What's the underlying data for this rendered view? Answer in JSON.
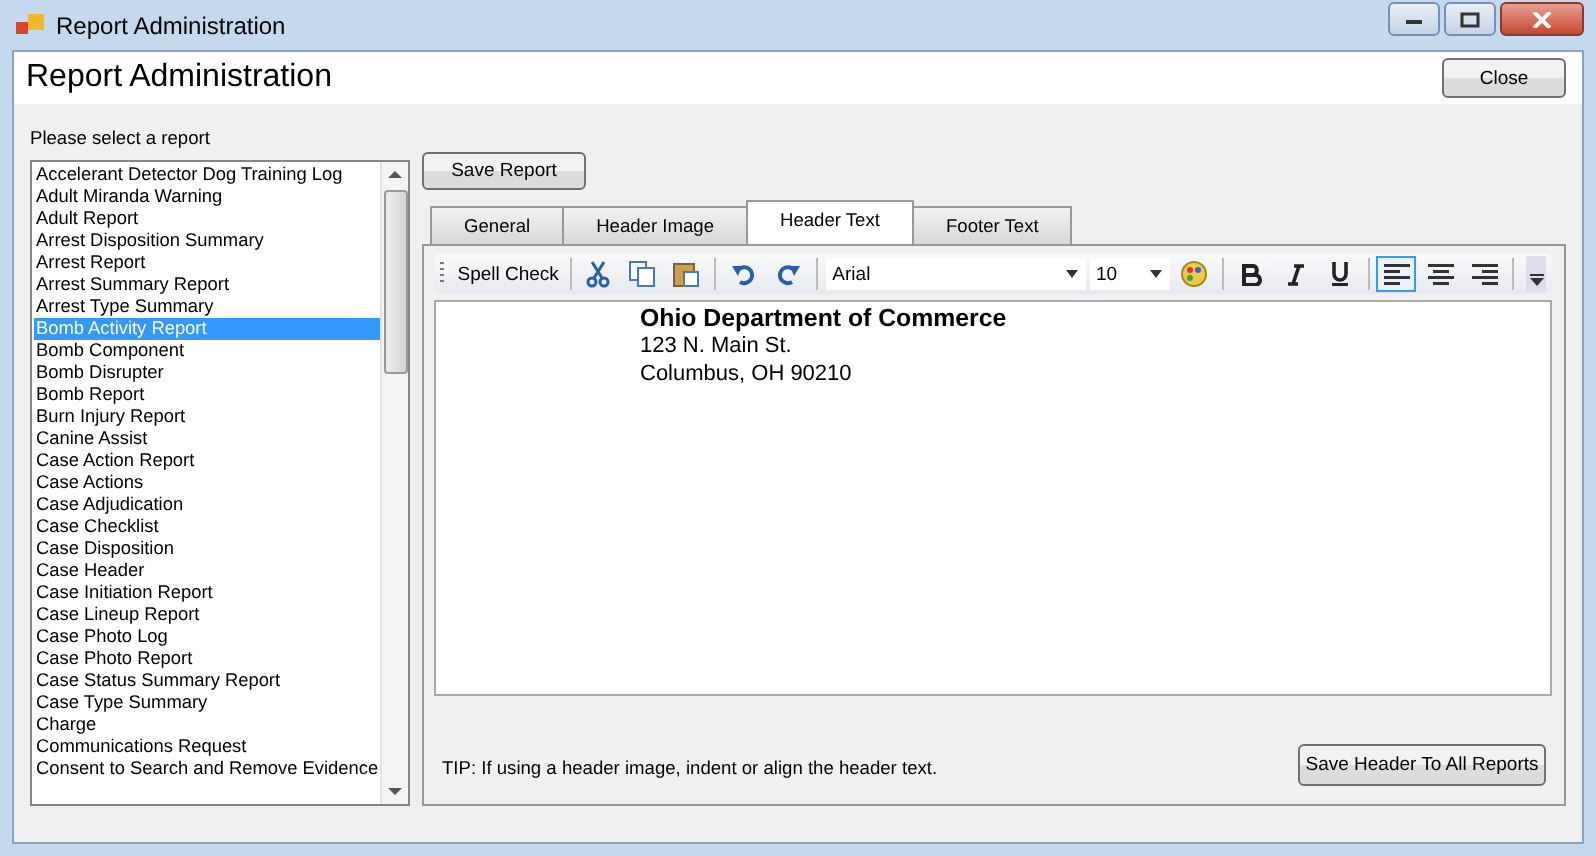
{
  "window": {
    "title": "Report Administration"
  },
  "header": {
    "title": "Report Administration",
    "close_button": "Close"
  },
  "report_list": {
    "label": "Please select a report",
    "items": [
      {
        "label": "Accelerant Detector Dog Training Log",
        "selected": false
      },
      {
        "label": "Adult Miranda Warning",
        "selected": false
      },
      {
        "label": "Adult Report",
        "selected": false
      },
      {
        "label": "Arrest Disposition Summary",
        "selected": false
      },
      {
        "label": "Arrest Report",
        "selected": false
      },
      {
        "label": "Arrest Summary Report",
        "selected": false
      },
      {
        "label": "Arrest Type Summary",
        "selected": false
      },
      {
        "label": "Bomb Activity Report",
        "selected": true
      },
      {
        "label": "Bomb Component",
        "selected": false
      },
      {
        "label": "Bomb Disrupter",
        "selected": false
      },
      {
        "label": "Bomb Report",
        "selected": false
      },
      {
        "label": "Burn Injury Report",
        "selected": false
      },
      {
        "label": "Canine Assist",
        "selected": false
      },
      {
        "label": "Case Action Report",
        "selected": false
      },
      {
        "label": "Case Actions",
        "selected": false
      },
      {
        "label": "Case Adjudication",
        "selected": false
      },
      {
        "label": "Case Checklist",
        "selected": false
      },
      {
        "label": "Case Disposition",
        "selected": false
      },
      {
        "label": "Case Header",
        "selected": false
      },
      {
        "label": "Case Initiation Report",
        "selected": false
      },
      {
        "label": "Case Lineup Report",
        "selected": false
      },
      {
        "label": "Case Photo Log",
        "selected": false
      },
      {
        "label": "Case Photo Report",
        "selected": false
      },
      {
        "label": "Case Status Summary Report",
        "selected": false
      },
      {
        "label": "Case Type Summary",
        "selected": false
      },
      {
        "label": "Charge",
        "selected": false
      },
      {
        "label": "Communications Request",
        "selected": false
      },
      {
        "label": "Consent to Search and Remove Evidence",
        "selected": false
      }
    ]
  },
  "save_report_button": "Save Report",
  "tabs": [
    {
      "label": "General",
      "selected": false
    },
    {
      "label": "Header Image",
      "selected": false
    },
    {
      "label": "Header Text",
      "selected": true
    },
    {
      "label": "Footer Text",
      "selected": false
    }
  ],
  "toolbar": {
    "spell_check": "Spell Check",
    "font": "Arial",
    "size": "10",
    "alignments": [
      {
        "kind": "left",
        "selected": true
      },
      {
        "kind": "center",
        "selected": false
      },
      {
        "kind": "right",
        "selected": false
      }
    ]
  },
  "editor": {
    "lines": [
      {
        "text": "Ohio Department of Commerce",
        "bold": true
      },
      {
        "text": "123 N. Main St.",
        "bold": false
      },
      {
        "text": "Columbus, OH 90210",
        "bold": false
      }
    ]
  },
  "tip": "TIP: If using a header image, indent or align the header text.",
  "save_header_button": "Save Header To All Reports"
}
